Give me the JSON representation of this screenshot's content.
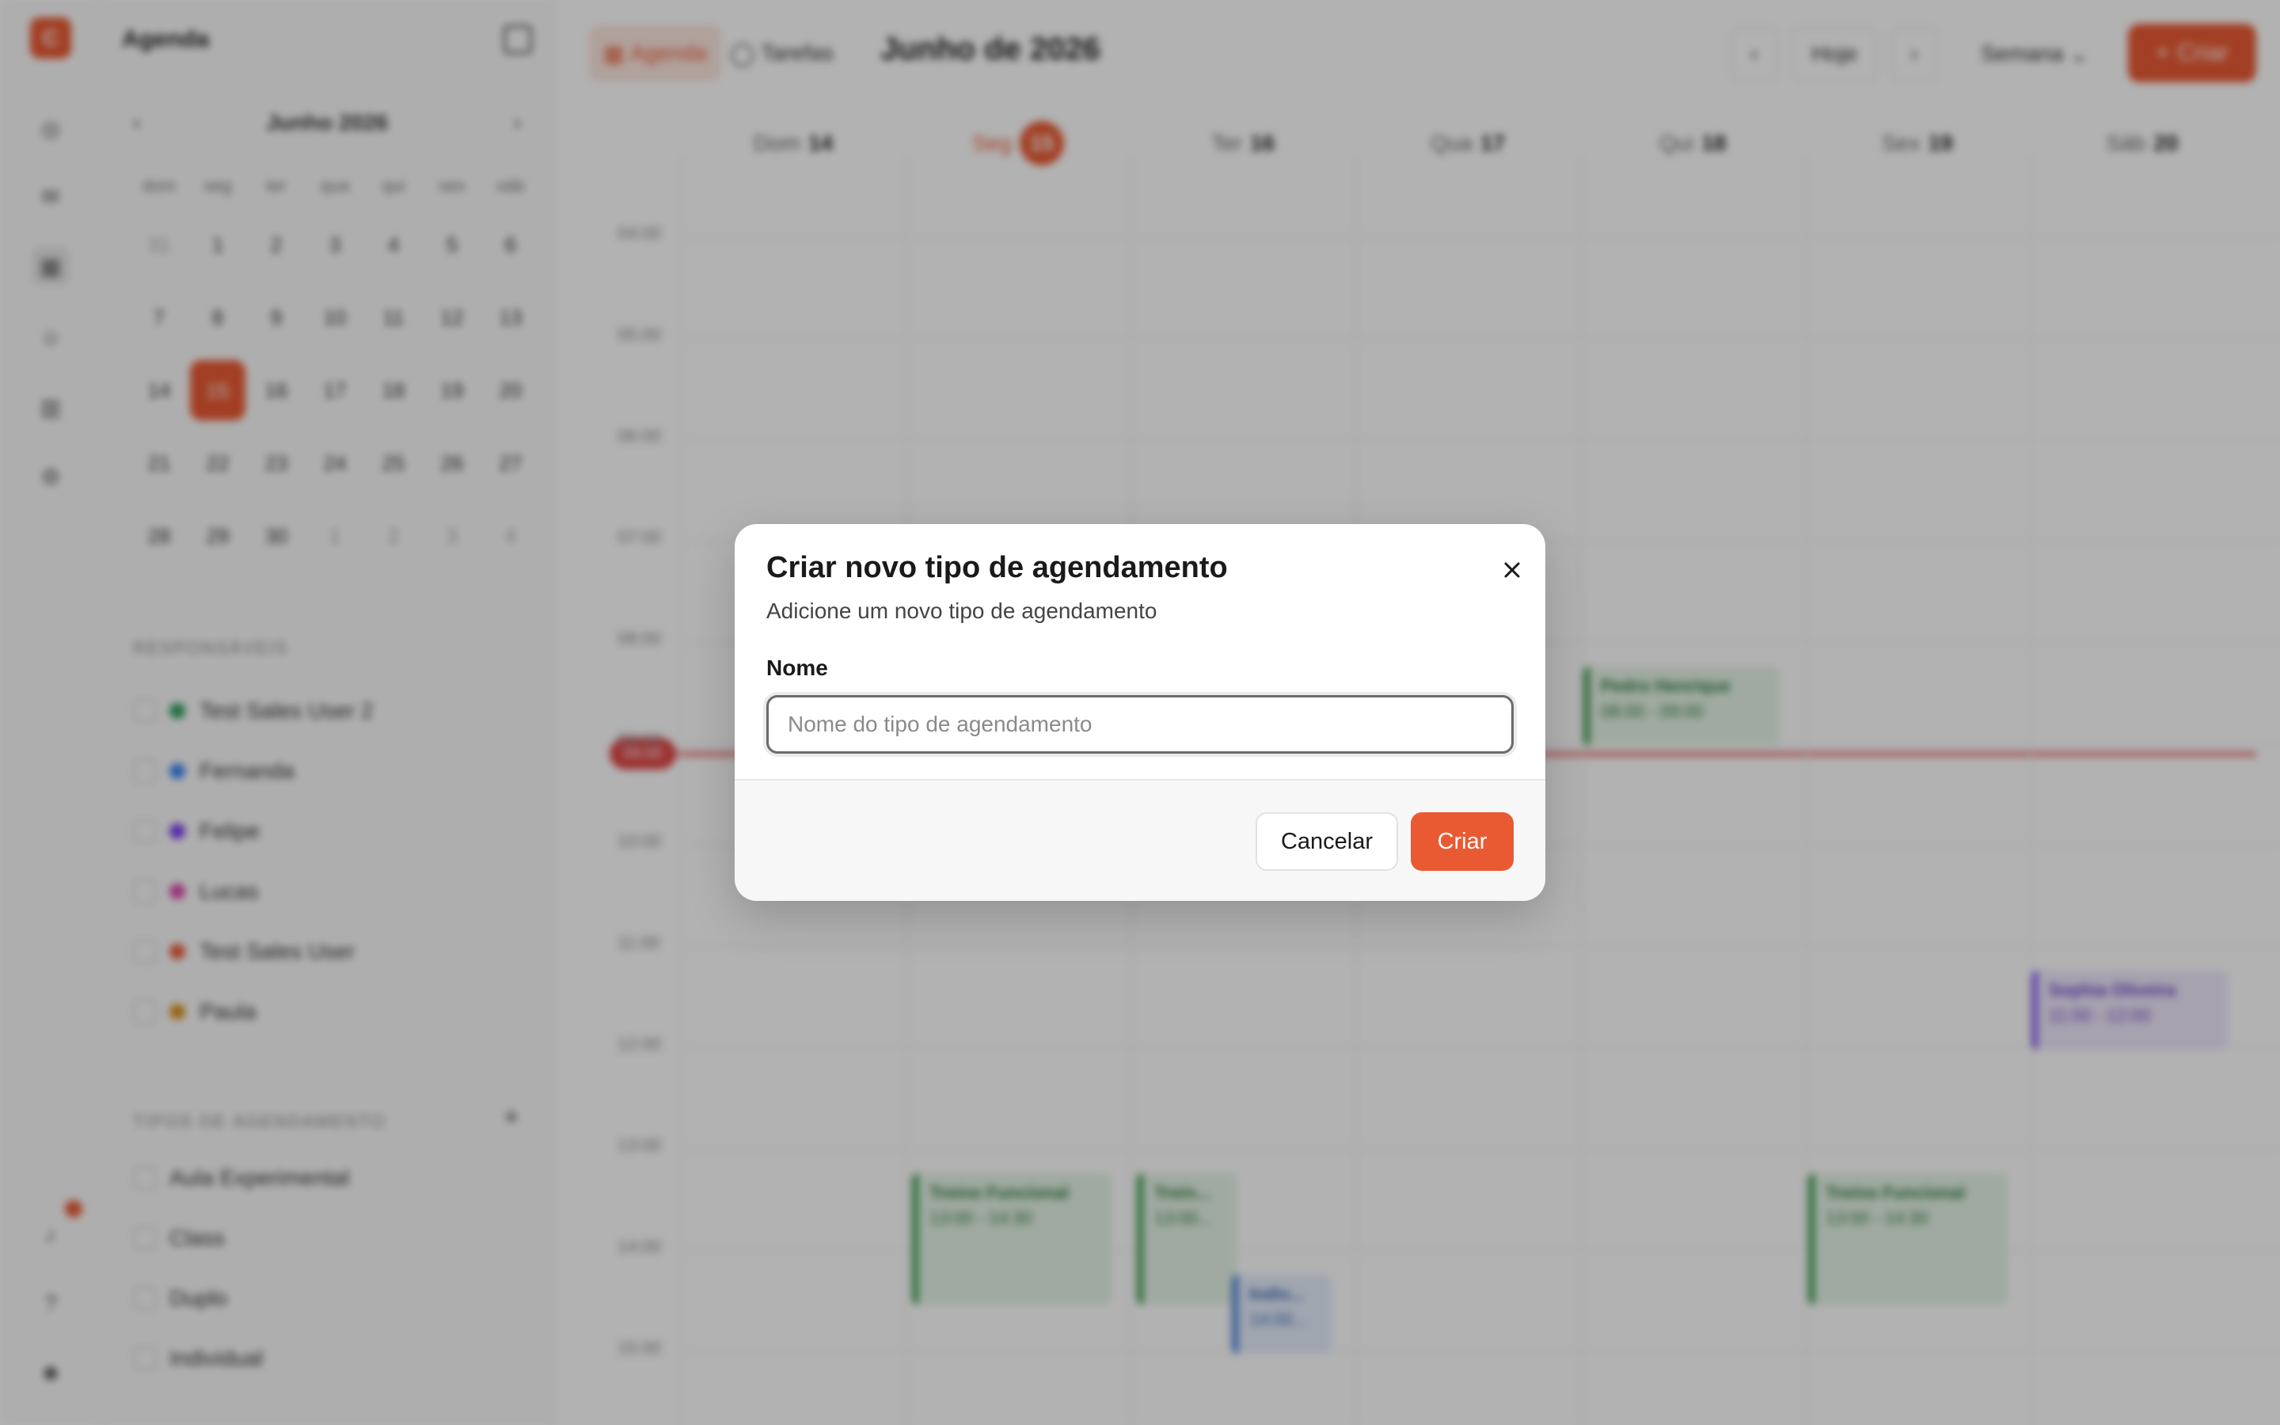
{
  "app": {
    "logo_letter": "C",
    "sidebar_title": "Agenda",
    "rail_icons": [
      "chat-icon",
      "messages-icon",
      "calendar-icon",
      "users-icon",
      "building-icon",
      "settings-icon",
      "notification-icon",
      "help-icon",
      "profile-icon"
    ],
    "mini_calendar": {
      "month_label": "Junho 2026",
      "weekdays": [
        "dom",
        "seg",
        "ter",
        "qua",
        "qui",
        "sex",
        "sáb"
      ],
      "weeks": [
        [
          "31",
          "1",
          "2",
          "3",
          "4",
          "5",
          "6"
        ],
        [
          "7",
          "8",
          "9",
          "10",
          "11",
          "12",
          "13"
        ],
        [
          "14",
          "15",
          "16",
          "17",
          "18",
          "19",
          "20"
        ],
        [
          "21",
          "22",
          "23",
          "24",
          "25",
          "26",
          "27"
        ],
        [
          "28",
          "29",
          "30",
          "1",
          "2",
          "3",
          "4"
        ]
      ],
      "selected_day": "15"
    },
    "responsaveis_title": "RESPONSÁVEIS",
    "responsaveis": [
      {
        "name": "Test Sales User 2",
        "color": "#2e9e5b"
      },
      {
        "name": "Fernanda",
        "color": "#3b82f6"
      },
      {
        "name": "Felipe",
        "color": "#7c3aed"
      },
      {
        "name": "Lucas",
        "color": "#d946a8"
      },
      {
        "name": "Test Sales User",
        "color": "#e95a33"
      },
      {
        "name": "Paula",
        "color": "#d9901a"
      }
    ],
    "tipos_title": "TIPOS DE AGENDAMENTO",
    "tipos": [
      "Aula Experimental",
      "Class",
      "Duplo",
      "Individual"
    ],
    "tabs": {
      "agenda": "Agenda",
      "tarefas": "Tarefas"
    },
    "header_title": "Junho de 2026",
    "today_button": "Hoje",
    "view_select": "Semana",
    "create_button": "Criar",
    "days": [
      {
        "label": "Dom",
        "num": "14"
      },
      {
        "label": "Seg",
        "num": "15"
      },
      {
        "label": "Ter",
        "num": "16"
      },
      {
        "label": "Qua",
        "num": "17"
      },
      {
        "label": "Qui",
        "num": "18"
      },
      {
        "label": "Sex",
        "num": "19"
      },
      {
        "label": "Sáb",
        "num": "20"
      }
    ],
    "time_labels": [
      "04:00",
      "05:00",
      "06:00",
      "07:00",
      "08:00",
      "09:00",
      "10:00",
      "11:00",
      "12:00",
      "13:00",
      "14:00",
      "15:00"
    ],
    "now_label": "09:00",
    "events": [
      {
        "name": "Pedro Henrique",
        "time": "08:00 - 09:00",
        "color": "green"
      },
      {
        "name": "Sophia Oliveira",
        "time": "11:00 - 12:00",
        "color": "purple"
      },
      {
        "name": "Treino Funcional",
        "time": "13:00 - 14:30",
        "color": "green"
      },
      {
        "name": "Trein...",
        "time": "13:00...",
        "color": "green"
      },
      {
        "name": "Indiv...",
        "time": "14:00...",
        "color": "blue"
      },
      {
        "name": "Treino Funcional",
        "time": "13:00 - 14:30",
        "color": "green"
      }
    ]
  },
  "modal": {
    "title": "Criar novo tipo de agendamento",
    "subtitle": "Adicione um novo tipo de agendamento",
    "name_label": "Nome",
    "name_value": "",
    "name_placeholder": "Nome do tipo de agendamento",
    "cancel_label": "Cancelar",
    "create_label": "Criar"
  },
  "colors": {
    "accent": "#e95a33",
    "overlay": "rgba(0,0,0,0.30)"
  }
}
